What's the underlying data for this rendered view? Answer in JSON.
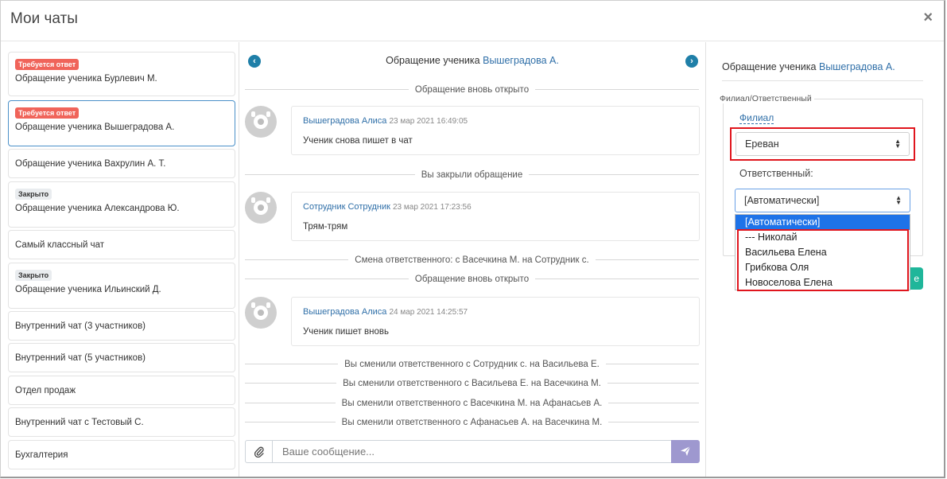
{
  "modal": {
    "title": "Мои чаты",
    "close_glyph": "×"
  },
  "chat_list": [
    {
      "badge": "Требуется ответ",
      "badge_type": "red",
      "name": "Обращение ученика Бурлевич М.",
      "active": false
    },
    {
      "badge": "Требуется ответ",
      "badge_type": "red",
      "name": "Обращение ученика Вышеградова А.",
      "active": true
    },
    {
      "badge": "",
      "badge_type": "",
      "name": "Обращение ученика Вахрулин А. Т.",
      "active": false
    },
    {
      "badge": "Закрыто",
      "badge_type": "gray",
      "name": "Обращение ученика Александрова Ю.",
      "active": false
    },
    {
      "badge": "",
      "badge_type": "",
      "name": "Самый классный чат",
      "active": false
    },
    {
      "badge": "Закрыто",
      "badge_type": "gray",
      "name": "Обращение ученика Ильинский Д.",
      "active": false
    },
    {
      "badge": "",
      "badge_type": "",
      "name": "Внутренний чат (3 участников)",
      "active": false
    },
    {
      "badge": "",
      "badge_type": "",
      "name": "Внутренний чат (5 участников)",
      "active": false
    },
    {
      "badge": "",
      "badge_type": "",
      "name": "Отдел продаж",
      "active": false
    },
    {
      "badge": "",
      "badge_type": "",
      "name": "Внутренний чат с Тестовый С.",
      "active": false
    },
    {
      "badge": "",
      "badge_type": "",
      "name": "Бухгалтерия",
      "active": false
    }
  ],
  "conversation": {
    "title_prefix": "Обращение ученика",
    "title_link": "Вышеградова А.",
    "prev_icon": "chevron-left-icon",
    "next_icon": "chevron-right-icon",
    "events": [
      {
        "kind": "system",
        "text": "Обращение вновь открыто"
      },
      {
        "kind": "message",
        "author": "Вышеградова Алиса",
        "time": "23 мар 2021 16:49:05",
        "text": "Ученик снова пишет в чат"
      },
      {
        "kind": "system",
        "text": "Вы закрыли обращение"
      },
      {
        "kind": "message",
        "author": "Сотрудник Сотрудник",
        "time": "23 мар 2021 17:23:56",
        "text": "Трям-трям"
      },
      {
        "kind": "system",
        "text": "Смена ответственного: с Васечкина М. на Сотрудник с."
      },
      {
        "kind": "system",
        "text": "Обращение вновь открыто"
      },
      {
        "kind": "message",
        "author": "Вышеградова Алиса",
        "time": "24 мар 2021 14:25:57",
        "text": "Ученик пишет вновь"
      },
      {
        "kind": "system",
        "text": "Вы сменили ответственного с Сотрудник с. на Васильева Е."
      },
      {
        "kind": "system",
        "text": "Вы сменили ответственного с Васильева Е. на Васечкина М."
      },
      {
        "kind": "system",
        "text": "Вы сменили ответственного с Васечкина М. на Афанасьев А."
      },
      {
        "kind": "system",
        "text": "Вы сменили ответственного с Афанасьев А. на Васечкина М."
      }
    ],
    "composer": {
      "placeholder": "Ваше сообщение...",
      "attach_icon": "paperclip-icon",
      "send_icon": "paper-plane-icon"
    }
  },
  "details": {
    "title_prefix": "Обращение ученика",
    "title_link": "Вышеградова А.",
    "fieldset_legend": "Филиал/Ответственный",
    "branch_link": "Филиал",
    "branch_value": "Ереван",
    "responsible_label": "Ответственный:",
    "responsible_value": "[Автоматически]",
    "responsible_options": [
      "[Автоматически]",
      "--- Николай",
      "Васильева Елена",
      "Грибкова Оля",
      "Новоселова Елена"
    ],
    "selected_option_index": 0,
    "highlight_color": "#e0151d"
  }
}
